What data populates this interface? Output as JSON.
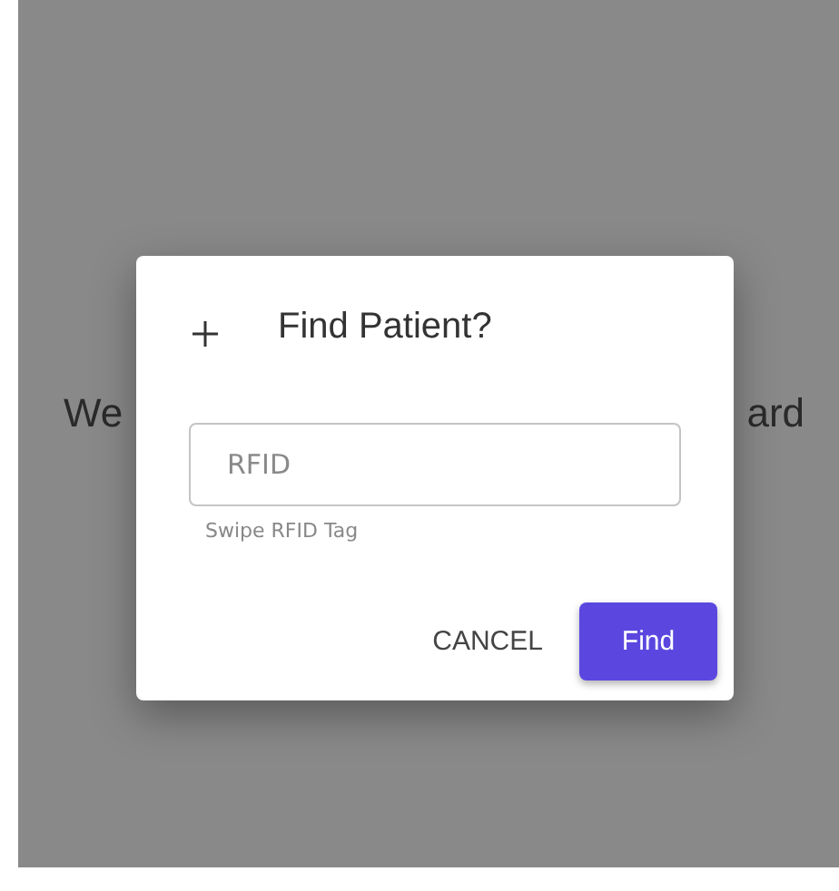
{
  "background": {
    "text_start": "We",
    "text_end": "ard"
  },
  "dialog": {
    "title": "Find Patient?",
    "field": {
      "placeholder": "RFID",
      "helper": "Swipe RFID Tag"
    },
    "buttons": [
      {
        "label": "CANCEL",
        "kind": "text"
      },
      {
        "label": "Find",
        "kind": "primary"
      }
    ]
  }
}
